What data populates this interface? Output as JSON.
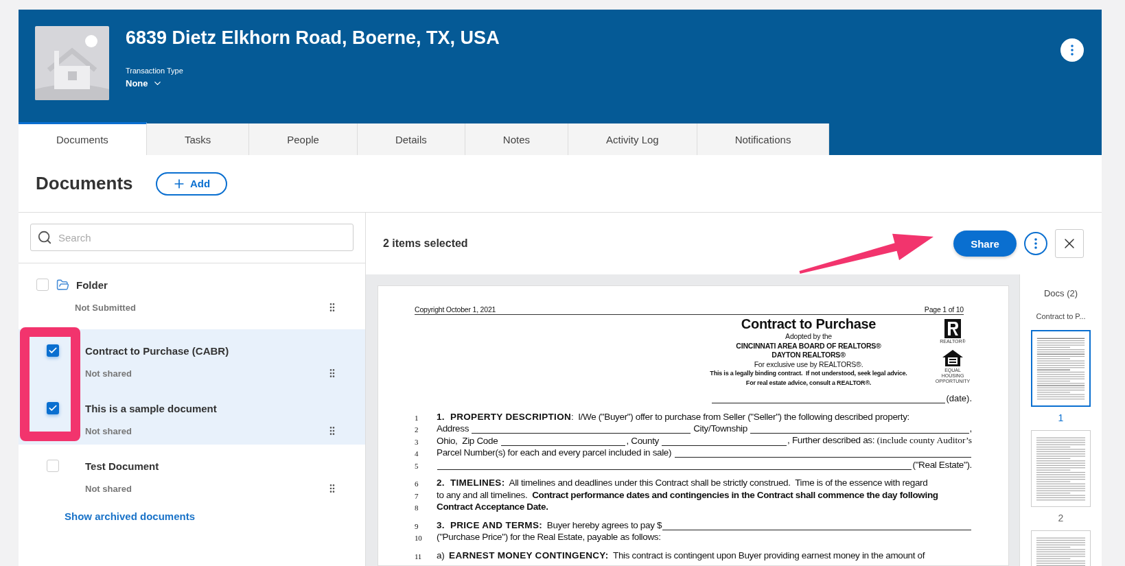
{
  "property": {
    "address": "6839 Dietz Elkhorn Road, Boerne, TX, USA",
    "transaction_type_label": "Transaction Type",
    "transaction_type": "None"
  },
  "tabs": [
    {
      "label": "Documents",
      "selected": true
    },
    {
      "label": "Tasks",
      "selected": false
    },
    {
      "label": "People",
      "selected": false
    },
    {
      "label": "Details",
      "selected": false
    },
    {
      "label": "Notes",
      "selected": false
    },
    {
      "label": "Activity Log",
      "selected": false
    },
    {
      "label": "Notifications",
      "selected": false
    }
  ],
  "documents_section": {
    "title": "Documents",
    "add_button": "Add"
  },
  "search": {
    "placeholder": "Search"
  },
  "items": [
    {
      "kind": "folder",
      "name": "Folder",
      "status": "Not Submitted",
      "checked": false,
      "selected": false
    },
    {
      "kind": "document",
      "name": "Contract to Purchase (CABR)",
      "status": "Not shared",
      "checked": true,
      "selected": true
    },
    {
      "kind": "document",
      "name": "This is a sample document",
      "status": "Not shared",
      "checked": true,
      "selected": true
    },
    {
      "kind": "document",
      "name": "Test Document",
      "status": "Not shared",
      "checked": false,
      "selected": false
    }
  ],
  "archived_link": "Show archived documents",
  "selection_bar": {
    "count_text": "2 items selected",
    "share_button": "Share"
  },
  "document_page": {
    "copyright": "Copyright October 1, 2021",
    "page_number": "Page 1 of 10",
    "title": "Contract to Purchase",
    "subtitle_lines": [
      {
        "kind": "plain",
        "text": "Adopted by the"
      },
      {
        "kind": "bold",
        "text": "CINCINNATI AREA BOARD OF REALTORS®"
      },
      {
        "kind": "bold",
        "text": "DAYTON REALTORS®"
      },
      {
        "kind": "plain",
        "text": "For exclusive use by REALTORS®."
      },
      {
        "kind": "small-bold",
        "text": "This is a legally binding contract.  If not understood, seek legal advice."
      },
      {
        "kind": "small-bold",
        "text": "For real estate advice, consult a REALTOR®."
      }
    ],
    "realtor_caption": "REALTOR®",
    "housing_caption": "EQUAL HOUSING OPPORTUNITY",
    "date_label": "(date).",
    "paragraphs": [
      {
        "lines": [
          {
            "number": "1",
            "segments": [
              {
                "kind": "heading",
                "text": "1.  PROPERTY DESCRIPTION"
              },
              {
                "kind": "text",
                "text": ":  I/We (\"Buyer\") offer to purchase from Seller (\"Seller\") the following described property:"
              }
            ]
          },
          {
            "number": "2",
            "segments": [
              {
                "kind": "text",
                "text": "Address "
              },
              {
                "kind": "blank"
              },
              {
                "kind": "text",
                "text": " City/Township "
              },
              {
                "kind": "blank"
              },
              {
                "kind": "text",
                "text": ","
              }
            ]
          },
          {
            "number": "3",
            "segments": [
              {
                "kind": "text",
                "text": "Ohio,  Zip Code "
              },
              {
                "kind": "blank"
              },
              {
                "kind": "text",
                "text": ", County "
              },
              {
                "kind": "blank"
              },
              {
                "kind": "text",
                "text": ", Further described as: "
              },
              {
                "kind": "serif",
                "text": "(include county Auditor’s"
              }
            ]
          },
          {
            "number": "4",
            "segments": [
              {
                "kind": "text",
                "text": "Parcel Number(s) for each and every parcel included in sale) "
              },
              {
                "kind": "blank"
              }
            ]
          },
          {
            "number": "5",
            "segments": [
              {
                "kind": "blank"
              },
              {
                "kind": "text",
                "text": "(\"Real Estate\")."
              }
            ]
          }
        ]
      },
      {
        "lines": [
          {
            "number": "6",
            "segments": [
              {
                "kind": "heading",
                "text": "2.  TIMELINES:"
              },
              {
                "kind": "text",
                "text": "  All timelines and deadlines under this Contract shall be strictly construed.  Time is of the essence with regard"
              }
            ]
          },
          {
            "number": "7",
            "segments": [
              {
                "kind": "text",
                "text": "to any and all timelines.  "
              },
              {
                "kind": "bold",
                "text": "Contract performance dates and contingencies in the Contract shall commence the day following"
              }
            ]
          },
          {
            "number": "8",
            "segments": [
              {
                "kind": "bold",
                "text": "Contract Acceptance Date."
              }
            ]
          }
        ]
      },
      {
        "lines": [
          {
            "number": "9",
            "segments": [
              {
                "kind": "heading",
                "text": "3.  PRICE AND TERMS:"
              },
              {
                "kind": "text",
                "text": "  Buyer hereby agrees to pay $"
              },
              {
                "kind": "blank"
              }
            ]
          },
          {
            "number": "10",
            "segments": [
              {
                "kind": "text",
                "text": "(\"Purchase Price\") for the Real Estate, payable as follows:"
              }
            ]
          }
        ]
      },
      {
        "lines": [
          {
            "number": "11",
            "segments": [
              {
                "kind": "text",
                "text": "a)  "
              },
              {
                "kind": "heading",
                "text": "EARNEST MONEY CONTINGENCY:"
              },
              {
                "kind": "text",
                "text": "  This contract is contingent upon Buyer providing earnest money in the amount of"
              }
            ]
          }
        ]
      }
    ]
  },
  "thumbnails": {
    "title": "Docs (2)",
    "document_name": "Contract to P...",
    "pages": [
      {
        "label": "1",
        "selected": true
      },
      {
        "label": "2",
        "selected": false
      }
    ]
  }
}
